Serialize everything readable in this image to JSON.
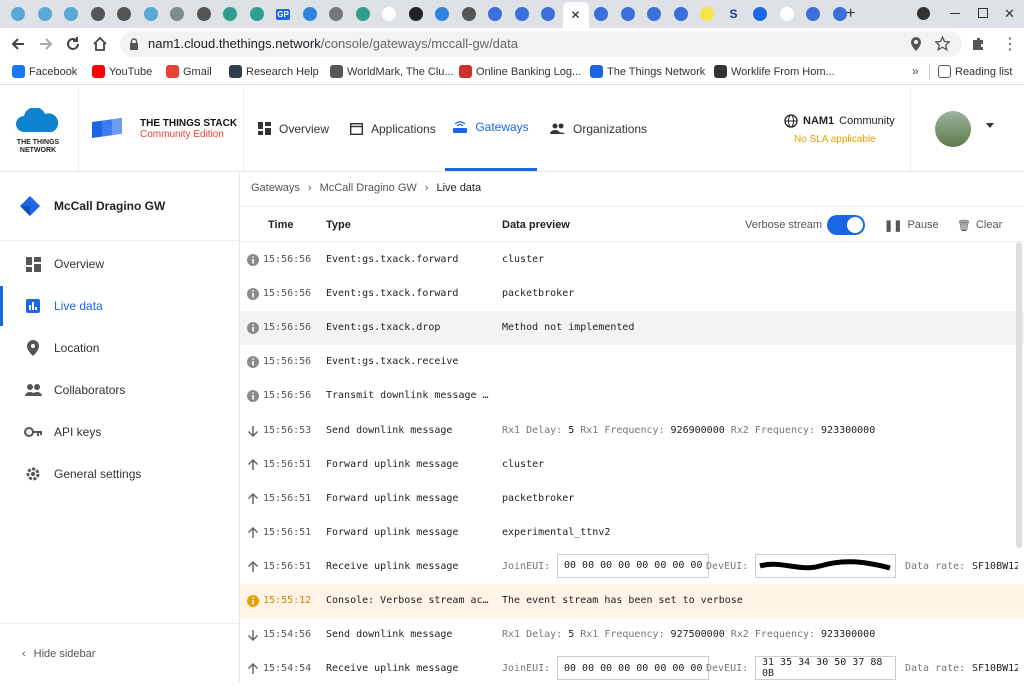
{
  "browser": {
    "url_host": "nam1.cloud.thethings.network",
    "url_path": "/console/gateways/mccall-gw/data",
    "new_tab": "+",
    "close": "✕",
    "tab_letters": {
      "gp": "GP",
      "s": "S"
    }
  },
  "bookmarks": [
    {
      "label": "Facebook",
      "color": "#1877f2"
    },
    {
      "label": "YouTube",
      "color": "#ff0000"
    },
    {
      "label": "Gmail",
      "color": "#ea4335"
    },
    {
      "label": "Research Help",
      "color": "#2c3e50"
    },
    {
      "label": "WorldMark, The Clu...",
      "color": "#555555"
    },
    {
      "label": "Online Banking Log...",
      "color": "#d32f2f"
    },
    {
      "label": "The Things Network",
      "color": "#1b66e4"
    },
    {
      "label": "Worklife From Hom...",
      "color": "#333333"
    }
  ],
  "bookmarks_more": "»",
  "reading_list": "Reading list",
  "brand": {
    "ttn_line1": "THE THINGS",
    "ttn_line2": "NETWORK",
    "stack_line1": "THE THINGS STACK",
    "stack_line2": "Community Edition"
  },
  "nav": [
    {
      "label": "Overview",
      "icon": "dashboard-icon"
    },
    {
      "label": "Applications",
      "icon": "window-icon"
    },
    {
      "label": "Gateways",
      "icon": "gateway-icon"
    },
    {
      "label": "Organizations",
      "icon": "people-icon"
    }
  ],
  "cluster": {
    "name": "NAM1",
    "community": "Community",
    "sla": "No SLA applicable"
  },
  "sidebar": {
    "title": "McCall Dragino GW",
    "items": [
      {
        "label": "Overview"
      },
      {
        "label": "Live data"
      },
      {
        "label": "Location"
      },
      {
        "label": "Collaborators"
      },
      {
        "label": "API keys"
      },
      {
        "label": "General settings"
      }
    ],
    "hide": "Hide sidebar"
  },
  "breadcrumb": [
    "Gateways",
    "McCall Dragino GW",
    "Live data"
  ],
  "table": {
    "headers": {
      "time": "Time",
      "type": "Type",
      "preview": "Data preview"
    },
    "verbose_label": "Verbose stream",
    "pause": "Pause",
    "clear": "Clear",
    "rows": [
      {
        "icon": "info",
        "time": "15:56:56",
        "type": "Event:gs.txack.forward",
        "preview": "cluster"
      },
      {
        "icon": "info",
        "time": "15:56:56",
        "type": "Event:gs.txack.forward",
        "preview": "packetbroker"
      },
      {
        "icon": "info",
        "time": "15:56:56",
        "type": "Event:gs.txack.drop",
        "preview": "Method not implemented"
      },
      {
        "icon": "info",
        "time": "15:56:56",
        "type": "Event:gs.txack.receive",
        "preview": ""
      },
      {
        "icon": "info",
        "time": "15:56:56",
        "type": "Transmit downlink message …",
        "preview": ""
      },
      {
        "icon": "down",
        "time": "15:56:53",
        "type": "Send downlink message",
        "downlink": {
          "rx1d_label": "Rx1 Delay:",
          "rx1d": "5",
          "rx1f_label": "Rx1 Frequency:",
          "rx1f": "926900000",
          "rx2f_label": "Rx2 Frequency:",
          "rx2f": "923300000"
        }
      },
      {
        "icon": "up",
        "time": "15:56:51",
        "type": "Forward uplink message",
        "preview": "cluster"
      },
      {
        "icon": "up",
        "time": "15:56:51",
        "type": "Forward uplink message",
        "preview": "packetbroker"
      },
      {
        "icon": "up",
        "time": "15:56:51",
        "type": "Forward uplink message",
        "preview": "experimental_ttnv2"
      },
      {
        "icon": "up",
        "time": "15:56:51",
        "type": "Receive uplink message",
        "uplink": {
          "join_label": "JoinEUI:",
          "join": "00 00 00 00 00 00 00 00",
          "dev_label": "DevEUI:",
          "dev": "",
          "rate_label": "Data rate:",
          "rate": "SF10BW12"
        }
      },
      {
        "icon": "warn",
        "time": "15:55:12",
        "type": "Console: Verbose stream ac…",
        "preview": "The event stream has been set to verbose"
      },
      {
        "icon": "down",
        "time": "15:54:56",
        "type": "Send downlink message",
        "downlink": {
          "rx1d_label": "Rx1 Delay:",
          "rx1d": "5",
          "rx1f_label": "Rx1 Frequency:",
          "rx1f": "927500000",
          "rx2f_label": "Rx2 Frequency:",
          "rx2f": "923300000"
        }
      },
      {
        "icon": "up",
        "time": "15:54:54",
        "type": "Receive uplink message",
        "uplink": {
          "join_label": "JoinEUI:",
          "join": "00 00 00 00 00 00 00 00",
          "dev_label": "DevEUI:",
          "dev": "31 35 34 30 50 37 88 0B",
          "rate_label": "Data rate:",
          "rate": "SF10BW12"
        }
      }
    ]
  },
  "colors": {
    "accent": "#1b66e4",
    "warn": "#e6a100",
    "info": "#8a8a8a"
  }
}
